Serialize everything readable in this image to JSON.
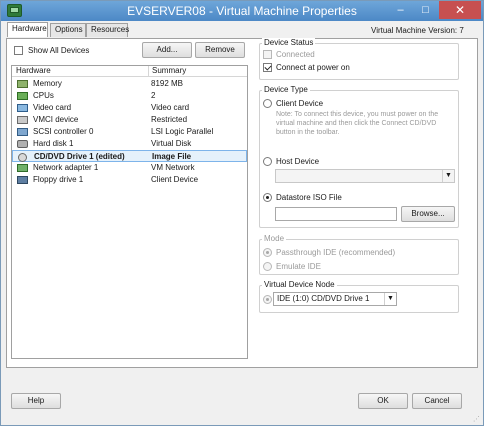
{
  "window": {
    "title": "EVSERVER08 - Virtual Machine Properties",
    "minimize_glyph": "–",
    "maximize_glyph": "□",
    "close_glyph": "✕"
  },
  "tabs": [
    {
      "label": "Hardware",
      "active": true
    },
    {
      "label": "Options",
      "active": false
    },
    {
      "label": "Resources",
      "active": false
    }
  ],
  "vm_version": "Virtual Machine Version: 7",
  "toolbar": {
    "show_all_label": "Show All Devices",
    "show_all_checked": false,
    "add_label": "Add...",
    "remove_label": "Remove"
  },
  "hardware": {
    "col_hardware": "Hardware",
    "col_summary": "Summary",
    "rows": [
      {
        "name": "Memory",
        "summary": "8192 MB",
        "icon": "memory-icon"
      },
      {
        "name": "CPUs",
        "summary": "2",
        "icon": "cpu-icon"
      },
      {
        "name": "Video card",
        "summary": "Video card",
        "icon": "video-card-icon"
      },
      {
        "name": "VMCI device",
        "summary": "Restricted",
        "icon": "vmci-icon"
      },
      {
        "name": "SCSI controller 0",
        "summary": "LSI Logic Parallel",
        "icon": "scsi-controller-icon"
      },
      {
        "name": "Hard disk 1",
        "summary": "Virtual Disk",
        "icon": "hard-disk-icon"
      },
      {
        "name": "CD/DVD Drive 1 (edited)",
        "summary": "Image File",
        "icon": "cd-dvd-icon",
        "selected": true
      },
      {
        "name": "Network adapter 1",
        "summary": "VM Network",
        "icon": "network-adapter-icon"
      },
      {
        "name": "Floppy drive 1",
        "summary": "Client Device",
        "icon": "floppy-icon"
      }
    ]
  },
  "device_status": {
    "title": "Device Status",
    "connected_label": "Connected",
    "connected_checked": false,
    "connected_enabled": false,
    "power_on_label": "Connect at power on",
    "power_on_checked": true
  },
  "device_type": {
    "title": "Device Type",
    "client_label": "Client Device",
    "client_note": "Note: To connect this device, you must power on the virtual machine and then click the Connect CD/DVD button in the toolbar.",
    "host_label": "Host Device",
    "host_value": "",
    "datastore_label": "Datastore ISO File",
    "datastore_path": "",
    "browse_label": "Browse...",
    "selected": "datastore"
  },
  "mode": {
    "title": "Mode",
    "passthrough_label": "Passthrough IDE (recommended)",
    "emulate_label": "Emulate IDE",
    "selected": "passthrough"
  },
  "virtual_device_node": {
    "title": "Virtual Device Node",
    "value": "IDE (1:0) CD/DVD Drive 1"
  },
  "footer": {
    "help_label": "Help",
    "ok_label": "OK",
    "cancel_label": "Cancel"
  },
  "colors": {
    "titlebar": "#4c88c6",
    "selection": "#e5f1fb",
    "close_button": "#c75050"
  }
}
